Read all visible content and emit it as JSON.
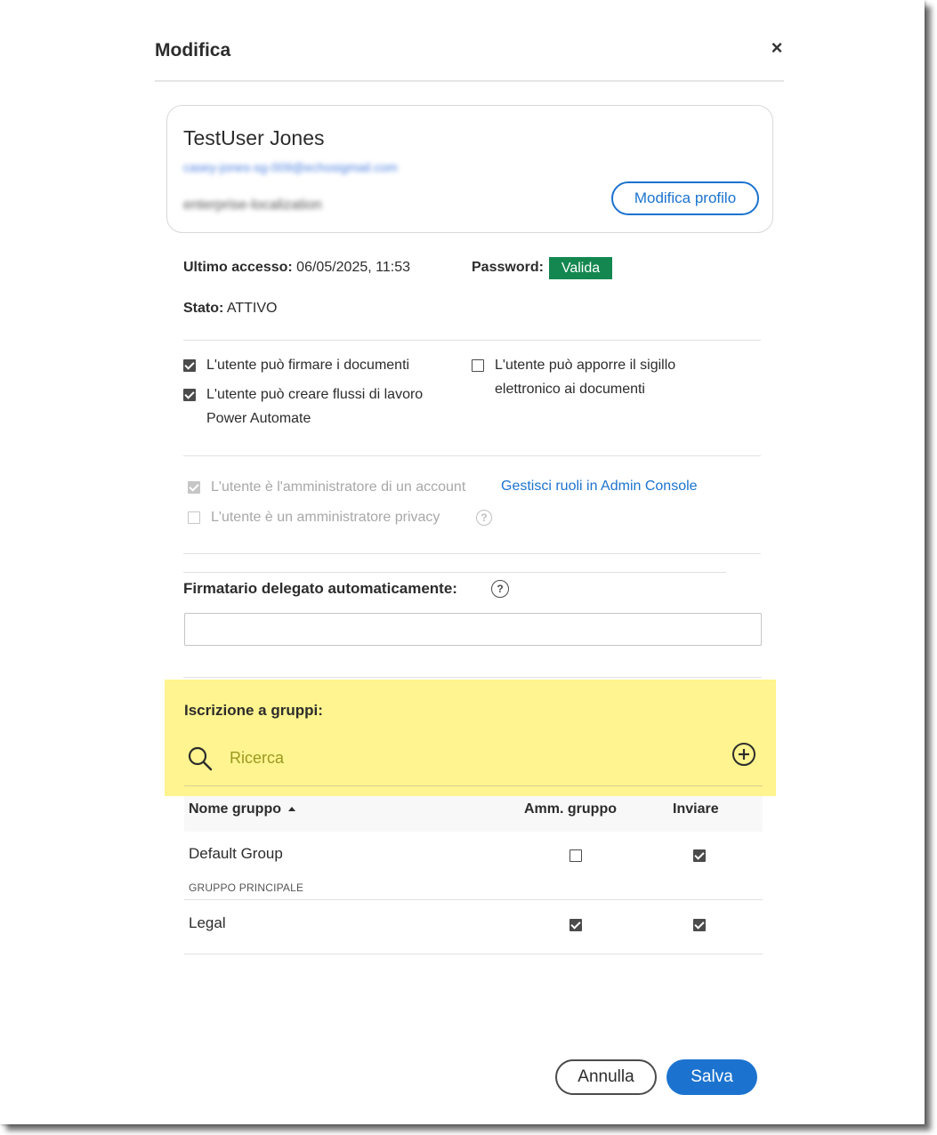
{
  "dialog": {
    "title": "Modifica",
    "close_symbol": "×"
  },
  "profile": {
    "name": "TestUser Jones",
    "email": "casey-jones-sg-009@echosigmail.com",
    "org": "enterprise-localization",
    "edit_button": "Modifica profilo"
  },
  "status": {
    "last_access_label": "Ultimo accesso:",
    "last_access_value": "06/05/2025, 11:53",
    "password_label": "Password:",
    "password_value": "Valida",
    "state_label": "Stato:",
    "state_value": "ATTIVO"
  },
  "permissions": {
    "sign": {
      "label": "L'utente può firmare i documenti",
      "checked": true
    },
    "flows": {
      "label_line1": "L'utente può creare flussi di lavoro",
      "label_line2": "Power Automate",
      "checked": true
    },
    "seal": {
      "label_line1": "L'utente può apporre il sigillo",
      "label_line2": "elettronico ai documenti",
      "checked": false
    }
  },
  "admin": {
    "account_admin": {
      "label": "L'utente è l'amministratore di un account",
      "checked": true,
      "disabled": true
    },
    "manage_link": "Gestisci ruoli in Admin Console",
    "privacy_admin": {
      "label": "L'utente è un amministratore privacy",
      "checked": false,
      "disabled": true
    }
  },
  "delegate": {
    "label": "Firmatario delegato automaticamente:",
    "value": ""
  },
  "groups": {
    "label": "Iscrizione a gruppi:",
    "search_placeholder": "Ricerca",
    "highlight_color": "#fff48f",
    "columns": {
      "name": "Nome gruppo",
      "admin": "Amm. gruppo",
      "send": "Inviare"
    },
    "rows": [
      {
        "name": "Default Group",
        "sublabel": "GRUPPO PRINCIPALE",
        "admin": false,
        "send": true
      },
      {
        "name": "Legal",
        "sublabel": "",
        "admin": true,
        "send": true
      }
    ]
  },
  "footer": {
    "cancel": "Annulla",
    "save": "Salva"
  },
  "colors": {
    "accent": "#1c73cf",
    "valid_badge": "#148750"
  }
}
